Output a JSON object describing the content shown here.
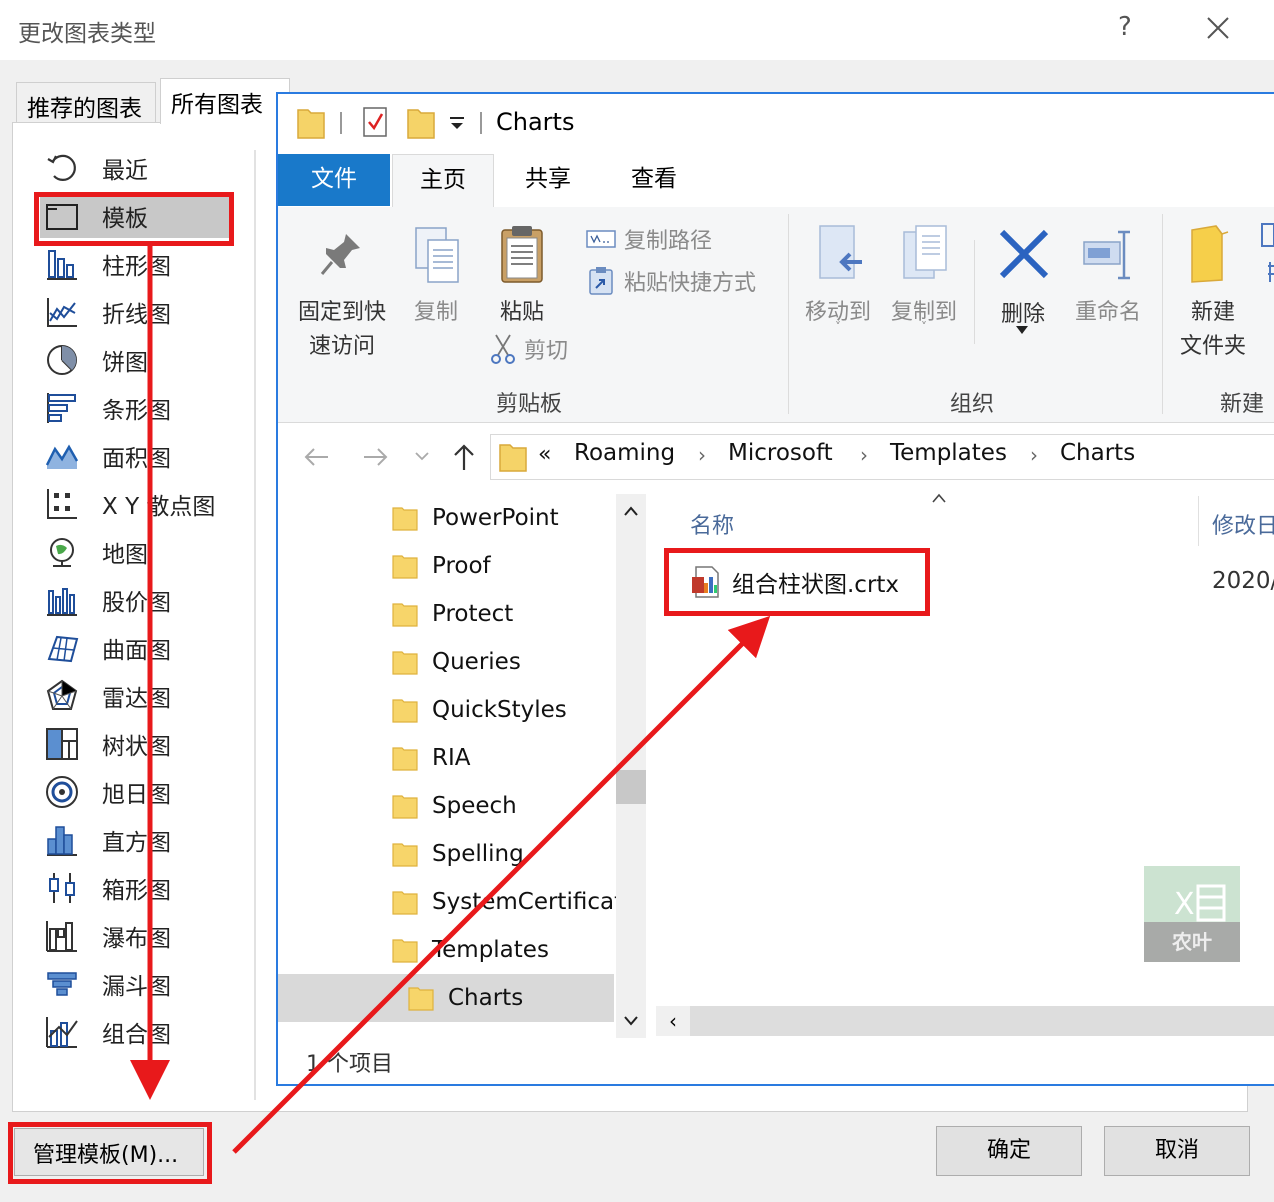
{
  "dialog": {
    "title": "更改图表类型",
    "help": "?",
    "tabs": [
      "推荐的图表",
      "所有图表"
    ],
    "chart_types": [
      {
        "label": "最近",
        "icon": "recent-icon"
      },
      {
        "label": "模板",
        "icon": "template-folder-icon"
      },
      {
        "label": "柱形图",
        "icon": "column-chart-icon"
      },
      {
        "label": "折线图",
        "icon": "line-chart-icon"
      },
      {
        "label": "饼图",
        "icon": "pie-chart-icon"
      },
      {
        "label": "条形图",
        "icon": "bar-chart-icon"
      },
      {
        "label": "面积图",
        "icon": "area-chart-icon"
      },
      {
        "label": "X Y 散点图",
        "icon": "scatter-chart-icon"
      },
      {
        "label": "地图",
        "icon": "map-chart-icon"
      },
      {
        "label": "股价图",
        "icon": "stock-chart-icon"
      },
      {
        "label": "曲面图",
        "icon": "surface-chart-icon"
      },
      {
        "label": "雷达图",
        "icon": "radar-chart-icon"
      },
      {
        "label": "树状图",
        "icon": "treemap-chart-icon"
      },
      {
        "label": "旭日图",
        "icon": "sunburst-chart-icon"
      },
      {
        "label": "直方图",
        "icon": "histogram-chart-icon"
      },
      {
        "label": "箱形图",
        "icon": "box-whisker-chart-icon"
      },
      {
        "label": "瀑布图",
        "icon": "waterfall-chart-icon"
      },
      {
        "label": "漏斗图",
        "icon": "funnel-chart-icon"
      },
      {
        "label": "组合图",
        "icon": "combo-chart-icon"
      }
    ],
    "manage_button": "管理模板(M)...",
    "ok_button": "确定",
    "cancel_button": "取消",
    "accent_color": "#e8191b"
  },
  "explorer": {
    "title": "Charts",
    "menu": {
      "file": "文件",
      "home": "主页",
      "share": "共享",
      "view": "查看"
    },
    "ribbon": {
      "pin_line1": "固定到快",
      "pin_line2": "速访问",
      "copy": "复制",
      "paste": "粘贴",
      "copy_path": "复制路径",
      "paste_shortcut": "粘贴快捷方式",
      "cut": "剪切",
      "group_clipboard": "剪贴板",
      "move_to": "移动到",
      "copy_to": "复制到",
      "delete": "删除",
      "rename": "重命名",
      "group_organize": "组织",
      "new_folder_line1": "新建",
      "new_folder_line2": "文件夹",
      "group_new": "新建"
    },
    "address": {
      "prefix": "«",
      "crumbs": [
        "Roaming",
        "Microsoft",
        "Templates",
        "Charts"
      ],
      "separator": "›"
    },
    "nav_items": [
      "PowerPoint",
      "Proof",
      "Protect",
      "Queries",
      "QuickStyles",
      "RIA",
      "Speech",
      "Spelling",
      "SystemCertificat",
      "Templates",
      "Charts"
    ],
    "columns": {
      "name": "名称",
      "modified": "修改日"
    },
    "file": {
      "name": "组合柱状图.crtx",
      "date": "2020/"
    },
    "status": "1 个项目",
    "watermark": "农叶"
  }
}
